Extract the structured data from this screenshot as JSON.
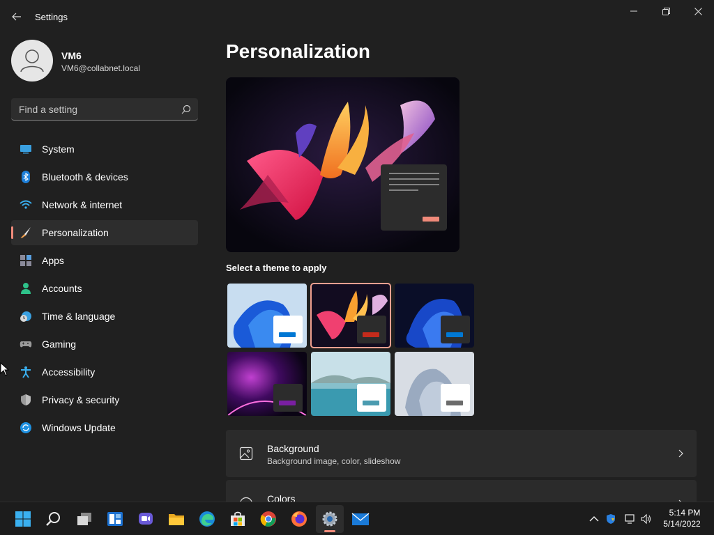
{
  "window": {
    "title": "Settings",
    "controls": [
      "minimize",
      "maximize",
      "close"
    ]
  },
  "profile": {
    "name": "VM6",
    "email": "VM6@collabnet.local"
  },
  "search": {
    "placeholder": "Find a setting"
  },
  "sidebar": {
    "items": [
      {
        "label": "System",
        "icon": "system-icon",
        "active": false
      },
      {
        "label": "Bluetooth & devices",
        "icon": "bluetooth-icon",
        "active": false
      },
      {
        "label": "Network & internet",
        "icon": "wifi-icon",
        "active": false
      },
      {
        "label": "Personalization",
        "icon": "brush-icon",
        "active": true
      },
      {
        "label": "Apps",
        "icon": "apps-icon",
        "active": false
      },
      {
        "label": "Accounts",
        "icon": "accounts-icon",
        "active": false
      },
      {
        "label": "Time & language",
        "icon": "time-language-icon",
        "active": false
      },
      {
        "label": "Gaming",
        "icon": "gamepad-icon",
        "active": false
      },
      {
        "label": "Accessibility",
        "icon": "accessibility-icon",
        "active": false
      },
      {
        "label": "Privacy & security",
        "icon": "shield-icon",
        "active": false
      },
      {
        "label": "Windows Update",
        "icon": "update-icon",
        "active": false
      }
    ]
  },
  "main": {
    "title": "Personalization",
    "themes_label": "Select a theme to apply",
    "themes": [
      {
        "id": "light-bloom",
        "selected": false,
        "accent": "#0078d4"
      },
      {
        "id": "glow-dark",
        "selected": true,
        "accent": "#c42b1c"
      },
      {
        "id": "dark-bloom",
        "selected": false,
        "accent": "#0078d4"
      },
      {
        "id": "captured-motion",
        "selected": false,
        "accent": "#7a1fa2"
      },
      {
        "id": "sunrise-lake",
        "selected": false,
        "accent": "#4a9bb0"
      },
      {
        "id": "flow",
        "selected": false,
        "accent": "#6b6b6b"
      }
    ],
    "cards": [
      {
        "title": "Background",
        "subtitle": "Background image, color, slideshow",
        "icon": "image-icon"
      },
      {
        "title": "Colors",
        "subtitle": "",
        "icon": "palette-icon"
      }
    ]
  },
  "taskbar": {
    "apps": [
      "start-icon",
      "search-icon",
      "task-view-icon",
      "widgets-icon",
      "chat-icon",
      "file-explorer-icon",
      "edge-icon",
      "store-icon",
      "chrome-icon",
      "firefox-icon",
      "settings-icon",
      "mail-icon"
    ],
    "active_app": "settings-icon",
    "time": "5:14 PM",
    "date": "5/14/2022"
  },
  "colors": {
    "accent": "#f08a7a",
    "background": "#202020",
    "card": "#2b2b2b"
  }
}
